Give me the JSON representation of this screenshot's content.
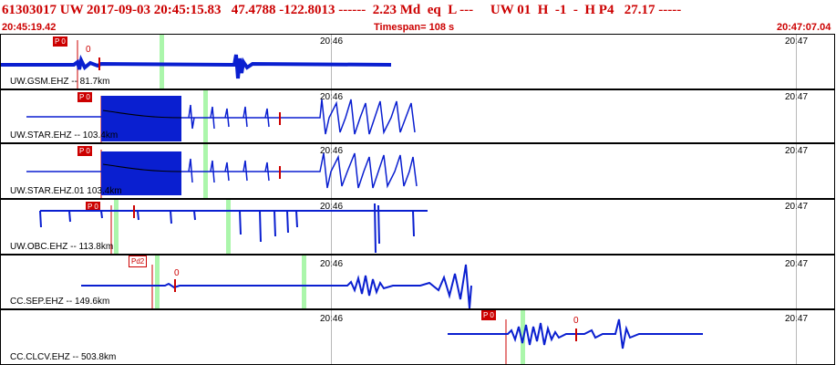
{
  "header": {
    "title": "61303017 UW 2017-09-03 20:45:15.83   47.4788 -122.8013 ------  2.23 Md  eq  L ---     UW 01  H  -1  -  H P4   27.17 -----",
    "start_time": "20:45:19.42",
    "timespan": "Timespan= 108 s",
    "end_time": "20:47:07.04"
  },
  "colors": {
    "trace": "#0a1fd0",
    "pick": "#cc0000",
    "marker": "#9cf59c",
    "text": "#cc0000"
  },
  "panels": [
    {
      "label": "UW.GSM.EHZ -- 81.7km",
      "pick": "P 0",
      "pick_style": "filled",
      "s_label": "0",
      "tick_a": "20:46",
      "tick_b": "20:47"
    },
    {
      "label": "UW.STAR.EHZ -- 103.4km",
      "pick": "P 0",
      "pick_style": "filled",
      "s_label": "",
      "tick_a": "20:46",
      "tick_b": "20:47"
    },
    {
      "label": "UW.STAR.EHZ.01 103.4km",
      "pick": "P 0",
      "pick_style": "filled",
      "s_label": "",
      "tick_a": "20:46",
      "tick_b": "20:47"
    },
    {
      "label": "UW.OBC.EHZ -- 113.8km",
      "pick": "P 0",
      "pick_style": "filled",
      "s_label": "",
      "tick_a": "20:46",
      "tick_b": "20:47"
    },
    {
      "label": "CC.SEP.EHZ -- 149.6km",
      "pick": "Pd2",
      "pick_style": "hollow",
      "s_label": "0",
      "tick_a": "20:46",
      "tick_b": "20:47"
    },
    {
      "label": "CC.CLCV.EHZ -- 503.8km",
      "pick": "P 0",
      "pick_style": "filled",
      "s_label": "0",
      "tick_a": "20:46",
      "tick_b": "20:47"
    }
  ]
}
